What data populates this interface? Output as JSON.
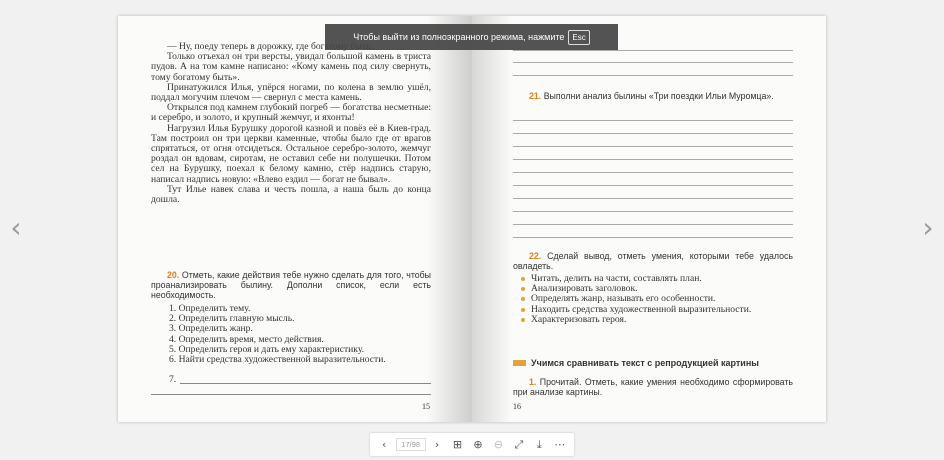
{
  "fullscreen_hint": {
    "message": "Чтобы выйти из полноэкранного режима, нажмите",
    "key": "Esc"
  },
  "nav": {
    "prev_icon": "chevron-left-icon",
    "next_icon": "chevron-right-icon",
    "prev_glyph": "‹",
    "next_glyph": "›"
  },
  "left_page": {
    "story_paragraphs": [
      "— Ну, поеду теперь в дорожку, где богатому быть.",
      "Только отъехал он три версты, увидал большой камень в триста пудов. А на том камне написано: «Кому камень под силу свернуть, тому богатому быть».",
      "Принатужился Илья, упёрся ногами, по колена в землю ушёл, поддал могучим плечом — свернул с места камень.",
      "Открылся под камнем глубокий погреб — богатства несметные: и серебро, и золото, и крупный жемчуг, и яхонты!",
      "Нагрузил Илья Бурушку дорогой казной и повёз её в Киев-град. Там построил он три церкви каменные, чтобы было где от врагов спрятаться, от огня отсидеться. Остальное серебро-золото, жемчуг роздал он вдовам, сиротам, не оставил себе ни полушечки. Потом сел на Бурушку, поехал к белому камню, стёр надпись старую, написал надпись новую: «Влево ездил — богат не бывал».",
      "Тут Илье навек слава и честь пошла, а наша быль до конца дошла."
    ],
    "task20": {
      "number": "20.",
      "text": "Отметь, какие действия тебе нужно сделать для того, чтобы проанализировать былину. Дополни список, если есть необходимость."
    },
    "task20_items": [
      "1. Определить тему.",
      "2. Определить главную мысль.",
      "3. Определить жанр.",
      "4. Определить время, место действия.",
      "5. Определить героя и дать ему характеристику.",
      "6. Найти средства художественной выразительности."
    ],
    "item7": "7.",
    "page_number": "15"
  },
  "right_page": {
    "task21": {
      "number": "21.",
      "text": "Выполни анализ былины «Три поездки Ильи Муромца»."
    },
    "task22": {
      "number": "22.",
      "text": "Сделай вывод, отметь умения, которыми тебе удалось овладеть."
    },
    "task22_items": [
      "Читать, делить на части, составлять план.",
      "Анализировать заголовок.",
      "Определять жанр, называть его особенности.",
      "Находить средства художественной выразительности.",
      "Характеризовать героя."
    ],
    "section_title": "Учимся сравнивать текст с репродукцией картины",
    "task1": {
      "number": "1.",
      "text": "Прочитай. Отметь, какие умения необходимо сформировать при анализе картины."
    },
    "page_number": "16"
  },
  "toolbar": {
    "page_indicator": "17/98",
    "prev_glyph": "‹",
    "next_glyph": "›",
    "thumbnails_glyph": "⊞",
    "zoom_in_glyph": "⊕",
    "zoom_out_glyph": "⊖",
    "fullscreen_glyph": "⤢",
    "download_glyph": "⤓",
    "more_glyph": "⋯"
  },
  "colors": {
    "accent": "#d9811c",
    "bullet": "#e3a23c",
    "toast_bg": "#464646"
  }
}
